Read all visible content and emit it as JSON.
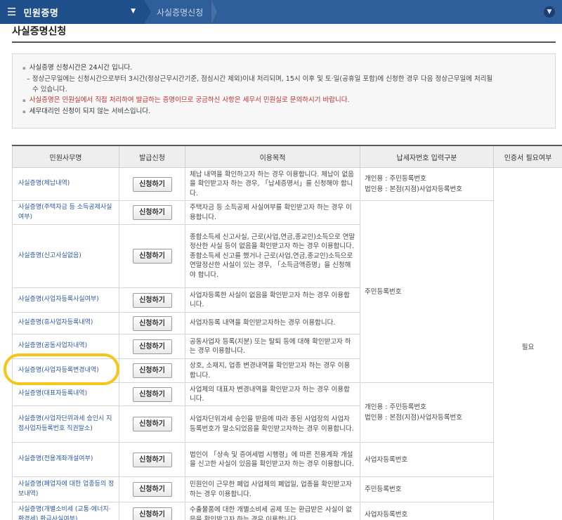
{
  "nav": {
    "menu_label": "민원증명",
    "breadcrumb": "사실증명신청",
    "hamburger_icon": "hamburger-menu-icon",
    "caret_icon": "caret-down-icon",
    "collapse_icon": "chevron-down-icon",
    "accent": "#2f5f9a"
  },
  "page": {
    "title": "사실증명신청"
  },
  "notice": {
    "line1": "사실증명 신청시간은 24시간 입니다.",
    "line2a": "정상근무일에는 신청시간으로부터 3시간(정상근무시간기준, 점심시간 제외)이내 처리되며, 15시 이후 및 토·일(공휴일 포함)에 신청한 경우 다음 정상근무일에 처리될",
    "line2b": "수 있습니다.",
    "line3": "사실증명은 민원실에서 직접 처리하여 발급하는 증명이므로 궁금하신 사항은 세무서 민원실로 문의하시기 바랍니다.",
    "line4": "세무대리인 신청이 되지 않는 서비스입니다."
  },
  "table": {
    "headers": [
      "민원사무명",
      "발급신청",
      "이용목적",
      "납세자번호 입력구분",
      "인증서 필요여부"
    ],
    "button_label": "신청하기",
    "rows": [
      {
        "name": "사실증명(체납내역)",
        "purpose": "체납 내역을 확인하고자 하는 경우 이용합니다. 체납이 없음을 확인받고자 하는 경우, 「납세증명서」를 신청해야 합니다."
      },
      {
        "name": "사실증명(주택자금 등 소득공제사실여부)",
        "purpose": "주택자금 등 소득공제 사실여부를 확인받고자 하는 경우 이용합니다."
      },
      {
        "name": "사실증명(신고사실없음)",
        "purpose": "종합소득세 신고사실, 근로(사업,연금,종교인)소득으로 연말정산한 사실 등이 없음을 확인받고자 하는 경우 이용합니다. 종합소득세 신고를 했거나 근로(사업,연금,종교인)소득으로 연말정산한 사실이 있는 경우, 「소득금액증명」을 신청해야 합니다."
      },
      {
        "name": "사실증명(사업자등록사실여부)",
        "purpose": "사업자등록한 사실이 없음을 확인받고자 하는 경우 이용합니다."
      },
      {
        "name": "사실증명(휴사업자등록내역)",
        "purpose": "사업자등록 내역을 확인받고자하는 경우 이용합니다."
      },
      {
        "name": "사실증명(공동사업자내역)",
        "purpose": "공동사업자 등록(지분) 또는 탈퇴 등에 대해 확인받고자 하는 경우 이용합니다."
      },
      {
        "name": "사실증명(사업자등록변경내역)",
        "purpose": "상호, 소재지, 업종 변경내역을 확인받고자 하는 경우 이용합니다."
      },
      {
        "name": "사실증명(대표자등록내역)",
        "purpose": "사업체의 대표자 변경내역을 확인받고자 하는 경우 이용합니다."
      },
      {
        "name": "사실증명(사업자단위과세 승인시 지점사업자등록번호 직권말소)",
        "purpose": "사업자단위과세 승인을 받음에 따라 종된 사업장의 사업자등록번호가 말소되었음을 확인받고자하는 경우 이용합니다."
      },
      {
        "name": "사실증명(전용계좌개설여부)",
        "purpose": "법인이 「상속 및 증여세법 시행령」에 따른 전용계좌 개설을 신고한 사실이 있음을 확인받고자 하는 경우 이용합니다."
      },
      {
        "name": "사실증명(폐업자에 대한 업종등의 정보내역)",
        "purpose": "민원인이 근무한 폐업 사업체의 폐업일, 업종을 확인받고자 하는 경우 이용합니다."
      },
      {
        "name": "사실증명(개별소비세 (교통·에너지·환경세) 환급사실여부)",
        "purpose": "수출물품에 대한 개별소비세 공제 또는 환급받은 사실이 없음을 확인받고자 하는 경우 이용합니다."
      }
    ],
    "taxid": {
      "group1": [
        "개인용 : 주민등록번호",
        "법인용 : 본점(지점)사업자등록번호"
      ],
      "group2": "주민등록번호",
      "group3": [
        "개인용 : 주민등록번호",
        "법인용 : 본점(지점)사업자등록번호"
      ],
      "group4": "사업자등록번호",
      "group5": "주민등록번호",
      "group6": "사업자등록번호"
    },
    "cert_required": "필요",
    "highlight_color": "#f5c518"
  }
}
